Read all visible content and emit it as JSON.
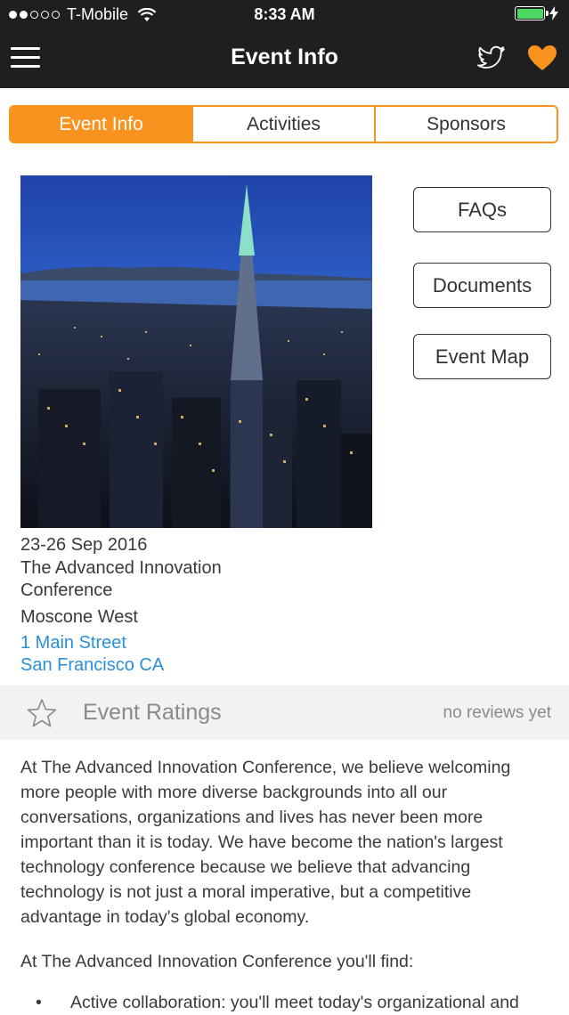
{
  "status_bar": {
    "carrier": "T-Mobile",
    "time": "8:33 AM"
  },
  "nav": {
    "title": "Event Info"
  },
  "tabs": [
    {
      "label": "Event Info",
      "active": true
    },
    {
      "label": "Activities",
      "active": false
    },
    {
      "label": "Sponsors",
      "active": false
    }
  ],
  "side_buttons": {
    "faqs": "FAQs",
    "documents": "Documents",
    "event_map": "Event Map"
  },
  "event": {
    "dates": "23-26 Sep 2016",
    "name_line1": "The Advanced Innovation",
    "name_line2": "Conference",
    "venue": "Moscone West",
    "address_line1": "1 Main Street",
    "address_line2": "San Francisco CA"
  },
  "ratings": {
    "label": "Event Ratings",
    "reviews": "no reviews yet"
  },
  "description": {
    "paragraph1": "At The Advanced Innovation Conference, we believe welcoming more people with more diverse backgrounds into all our conversations, organizations and lives has never been more important than it is today. We have become the nation's largest technology conference because we believe that advancing technology is not just a moral imperative, but a competitive advantage in today's global economy.",
    "paragraph2": "At The Advanced Innovation Conference you'll find:",
    "bullet1": "Active collaboration: you'll meet today's organizational and"
  },
  "colors": {
    "accent": "#f7931e",
    "topbar": "#1f1f1f",
    "link": "#2a8fd6",
    "battery": "#4cd964"
  },
  "icons": [
    "hamburger-menu-icon",
    "twitter-icon",
    "heart-icon",
    "star-outline-icon",
    "wifi-icon",
    "battery-icon",
    "charging-icon"
  ]
}
